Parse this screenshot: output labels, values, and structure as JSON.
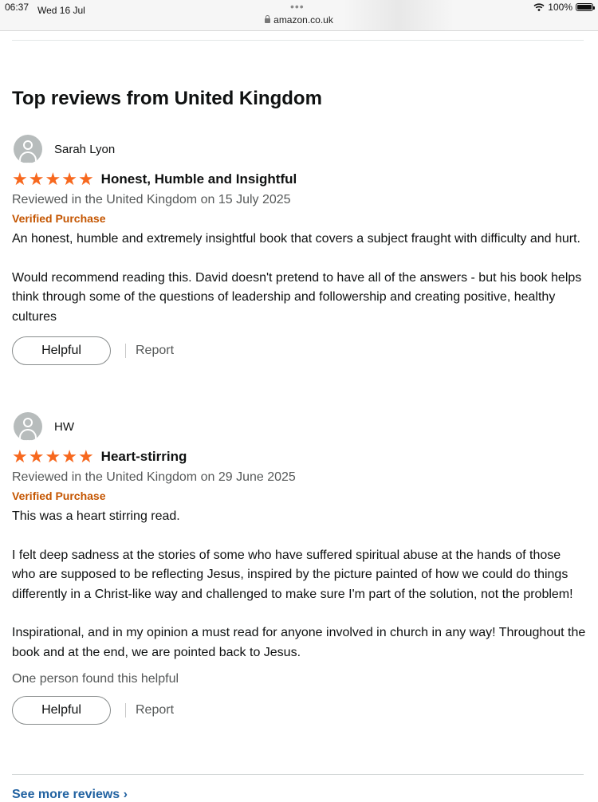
{
  "status_bar": {
    "time": "06:37",
    "date": "Wed 16 Jul",
    "url": "amazon.co.uk",
    "battery": "100%",
    "icons": [
      "wifi-icon",
      "battery-icon",
      "lock-icon"
    ]
  },
  "page": {
    "title": "Top reviews from United Kingdom",
    "see_more": "See more reviews ›"
  },
  "colors": {
    "star": "#f7681e",
    "verified": "#c45500",
    "link": "#2162a1",
    "muted": "#565959"
  },
  "reviews": [
    {
      "author": "Sarah Lyon",
      "rating": 5,
      "title": "Honest, Humble and Insightful",
      "date": "Reviewed in the United Kingdom on 15 July 2025",
      "verified": "Verified Purchase",
      "paragraphs": [
        "An honest, humble and extremely insightful book that covers a subject fraught with difficulty and hurt.",
        "Would recommend reading this. David doesn't pretend to have all of the answers - but his book helps think through some of the questions of leadership and followership and creating positive, healthy cultures"
      ],
      "helpful_label": "Helpful",
      "report_label": "Report"
    },
    {
      "author": "HW",
      "rating": 5,
      "title": "Heart-stirring",
      "date": "Reviewed in the United Kingdom on 29 June 2025",
      "verified": "Verified Purchase",
      "paragraphs": [
        "This was a heart stirring read.",
        "I felt deep sadness at the stories of some who have suffered spiritual abuse at the hands of those who are supposed to be reflecting Jesus, inspired by the picture painted of how we could do things differently in a Christ-like way and challenged to make sure I'm part of the solution, not the problem!",
        "Inspirational, and in my opinion a must read for anyone involved in church in any way! Throughout the book and at the end, we are pointed back to Jesus."
      ],
      "helpful_count": "One person found this helpful",
      "helpful_label": "Helpful",
      "report_label": "Report"
    }
  ]
}
